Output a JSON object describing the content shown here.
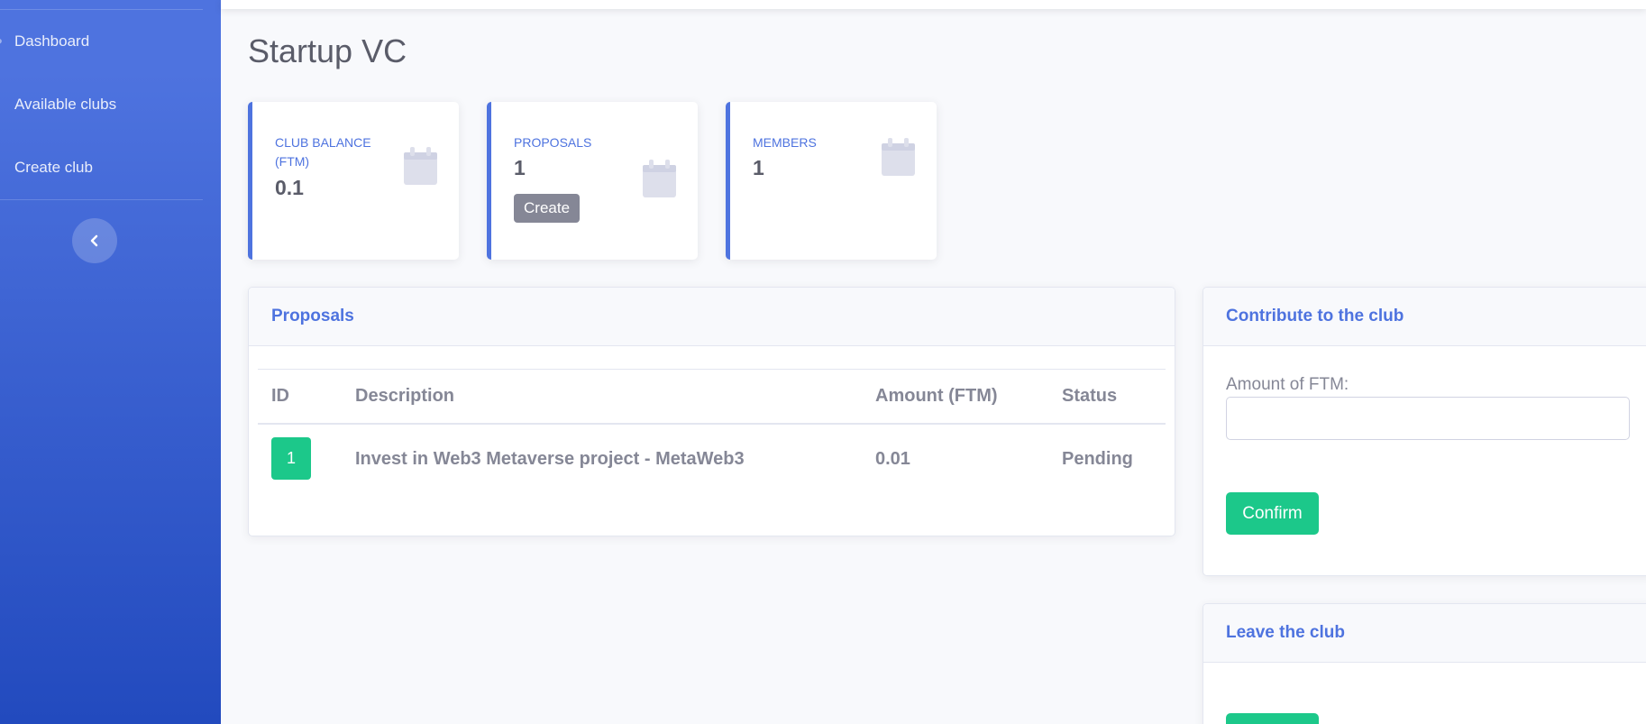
{
  "sidebar": {
    "items": [
      {
        "label": "Dashboard"
      },
      {
        "label": "Available clubs"
      },
      {
        "label": "Create club"
      }
    ]
  },
  "page": {
    "title": "Startup VC"
  },
  "stats": {
    "balance": {
      "label": "Club Balance (FTM)",
      "value": "0.1"
    },
    "proposals": {
      "label": "Proposals",
      "value": "1",
      "button": "Create"
    },
    "members": {
      "label": "Members",
      "value": "1"
    }
  },
  "proposals_panel": {
    "title": "Proposals",
    "columns": [
      "ID",
      "Description",
      "Amount (FTM)",
      "Status"
    ],
    "rows": [
      {
        "id": "1",
        "description": "Invest in Web3 Metaverse project - MetaWeb3",
        "amount": "0.01",
        "status": "Pending"
      }
    ]
  },
  "contribute_panel": {
    "title": "Contribute to the club",
    "field_label": "Amount of FTM:",
    "input_value": "",
    "button": "Confirm"
  },
  "leave_panel": {
    "title": "Leave the club"
  },
  "colors": {
    "primary": "#4e73df",
    "success": "#1cc88a",
    "secondary": "#858796"
  }
}
